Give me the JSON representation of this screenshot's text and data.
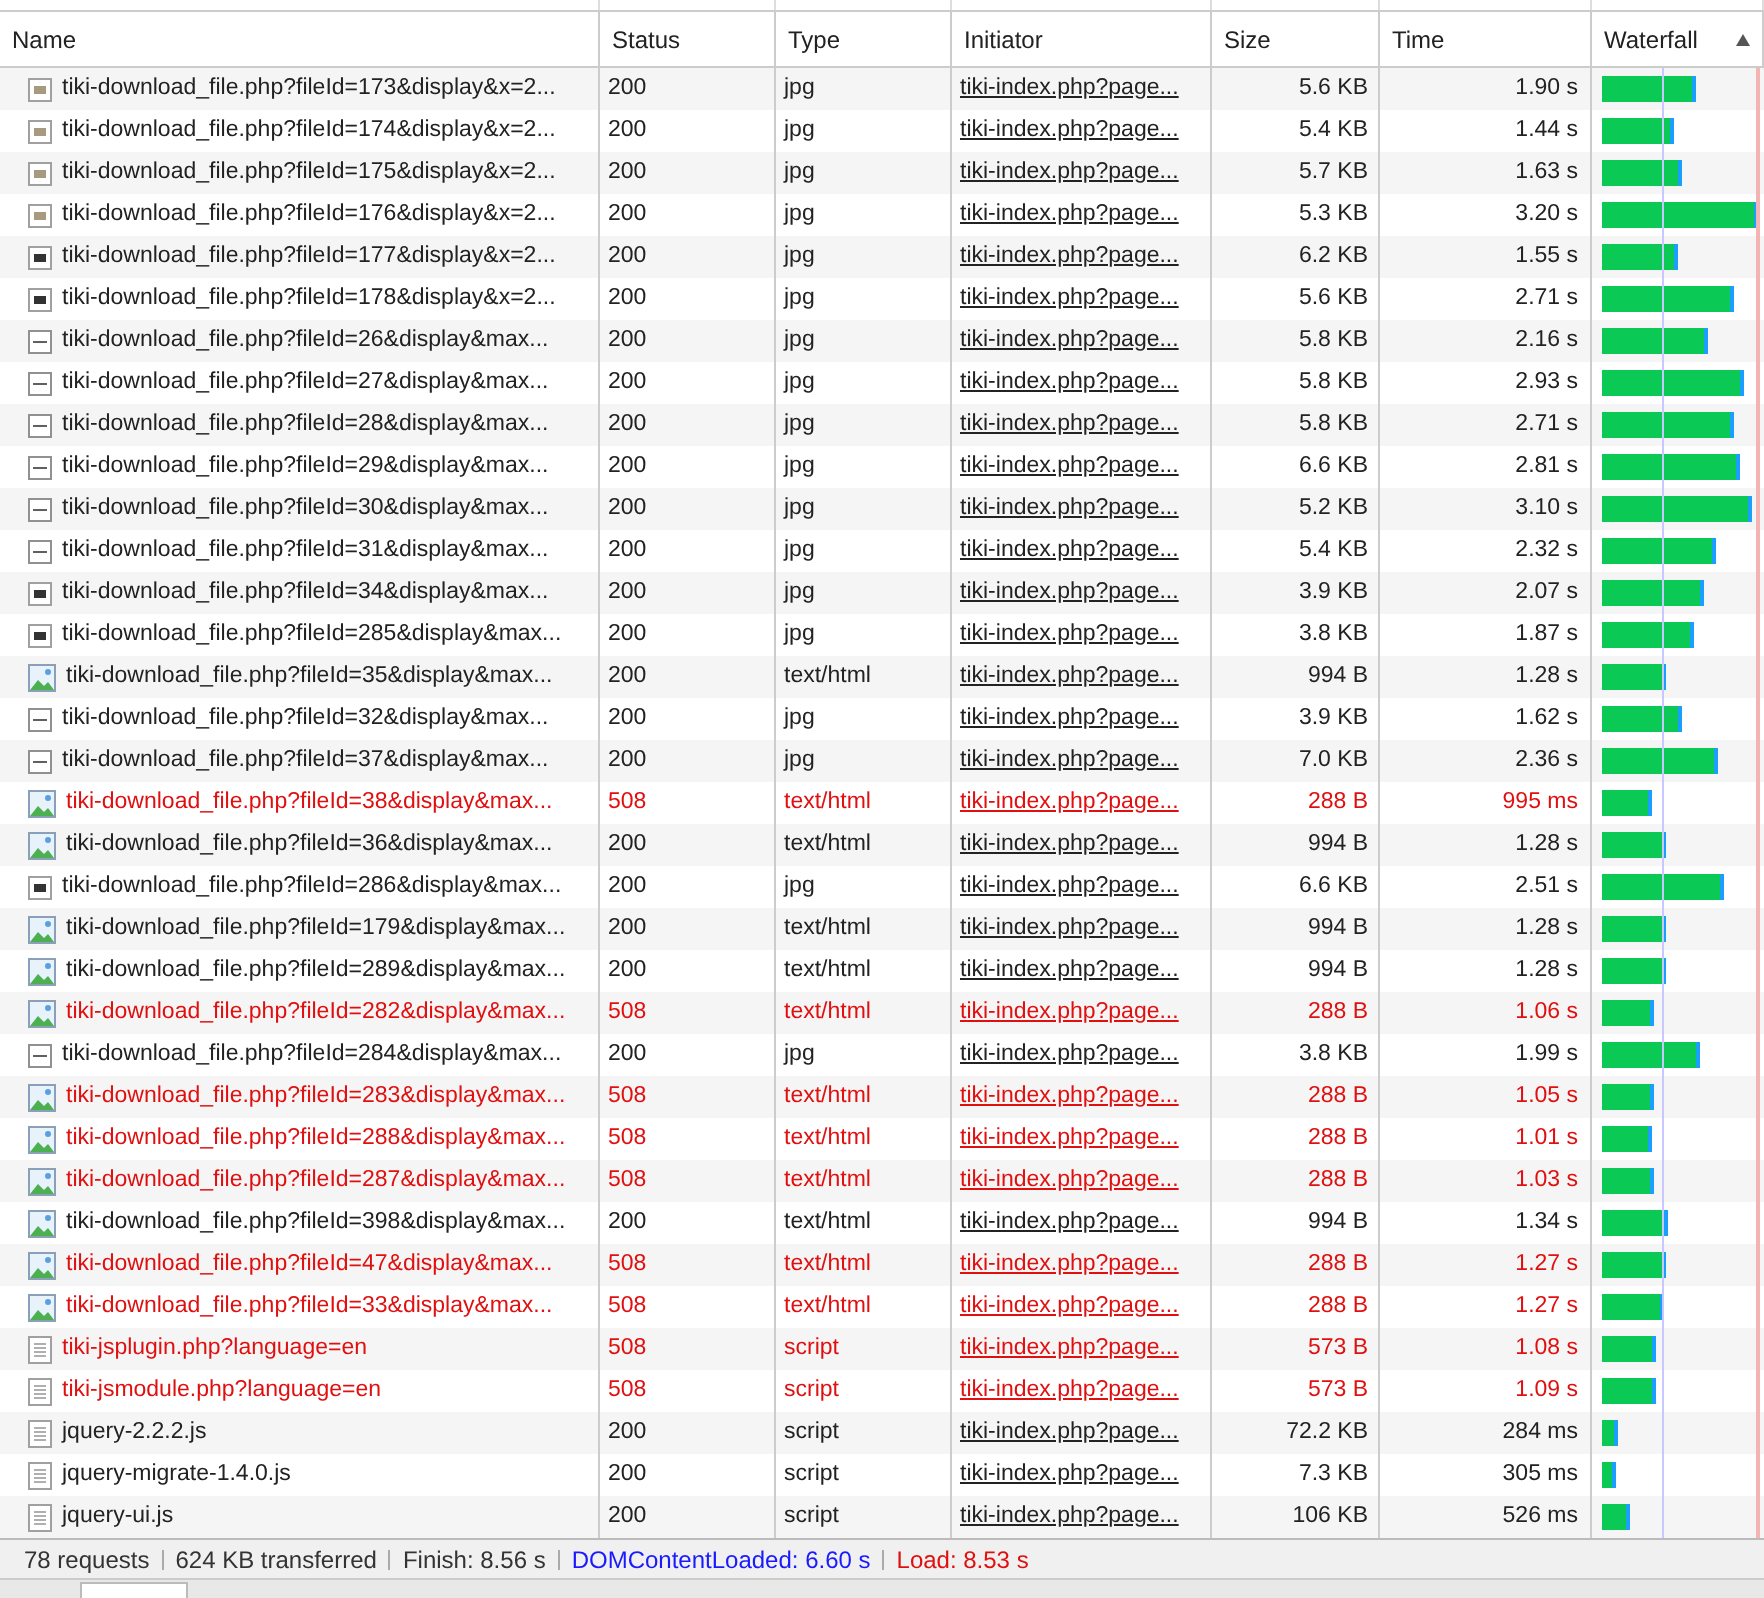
{
  "columns": [
    "Name",
    "Status",
    "Type",
    "Initiator",
    "Size",
    "Time",
    "Waterfall"
  ],
  "rows": [
    {
      "kind": "image",
      "name": "tiki-download_file.php?fileId=173&display&x=2...",
      "status": "200",
      "type": "jpg",
      "initiator": "tiki-index.php?page...",
      "size": "5.6 KB",
      "time": "1.90 s",
      "error": false
    },
    {
      "kind": "image",
      "name": "tiki-download_file.php?fileId=174&display&x=2...",
      "status": "200",
      "type": "jpg",
      "initiator": "tiki-index.php?page...",
      "size": "5.4 KB",
      "time": "1.44 s",
      "error": false
    },
    {
      "kind": "image",
      "name": "tiki-download_file.php?fileId=175&display&x=2...",
      "status": "200",
      "type": "jpg",
      "initiator": "tiki-index.php?page...",
      "size": "5.7 KB",
      "time": "1.63 s",
      "error": false
    },
    {
      "kind": "image",
      "name": "tiki-download_file.php?fileId=176&display&x=2...",
      "status": "200",
      "type": "jpg",
      "initiator": "tiki-index.php?page...",
      "size": "5.3 KB",
      "time": "3.20 s",
      "error": false
    },
    {
      "kind": "photo",
      "name": "tiki-download_file.php?fileId=177&display&x=2...",
      "status": "200",
      "type": "jpg",
      "initiator": "tiki-index.php?page...",
      "size": "6.2 KB",
      "time": "1.55 s",
      "error": false
    },
    {
      "kind": "photo",
      "name": "tiki-download_file.php?fileId=178&display&x=2...",
      "status": "200",
      "type": "jpg",
      "initiator": "tiki-index.php?page...",
      "size": "5.6 KB",
      "time": "2.71 s",
      "error": false
    },
    {
      "kind": "blank",
      "name": "tiki-download_file.php?fileId=26&display&max...",
      "status": "200",
      "type": "jpg",
      "initiator": "tiki-index.php?page...",
      "size": "5.8 KB",
      "time": "2.16 s",
      "error": false
    },
    {
      "kind": "blank",
      "name": "tiki-download_file.php?fileId=27&display&max...",
      "status": "200",
      "type": "jpg",
      "initiator": "tiki-index.php?page...",
      "size": "5.8 KB",
      "time": "2.93 s",
      "error": false
    },
    {
      "kind": "blank",
      "name": "tiki-download_file.php?fileId=28&display&max...",
      "status": "200",
      "type": "jpg",
      "initiator": "tiki-index.php?page...",
      "size": "5.8 KB",
      "time": "2.71 s",
      "error": false
    },
    {
      "kind": "blank",
      "name": "tiki-download_file.php?fileId=29&display&max...",
      "status": "200",
      "type": "jpg",
      "initiator": "tiki-index.php?page...",
      "size": "6.6 KB",
      "time": "2.81 s",
      "error": false
    },
    {
      "kind": "blank",
      "name": "tiki-download_file.php?fileId=30&display&max...",
      "status": "200",
      "type": "jpg",
      "initiator": "tiki-index.php?page...",
      "size": "5.2 KB",
      "time": "3.10 s",
      "error": false
    },
    {
      "kind": "blank",
      "name": "tiki-download_file.php?fileId=31&display&max...",
      "status": "200",
      "type": "jpg",
      "initiator": "tiki-index.php?page...",
      "size": "5.4 KB",
      "time": "2.32 s",
      "error": false
    },
    {
      "kind": "photo",
      "name": "tiki-download_file.php?fileId=34&display&max...",
      "status": "200",
      "type": "jpg",
      "initiator": "tiki-index.php?page...",
      "size": "3.9 KB",
      "time": "2.07 s",
      "error": false
    },
    {
      "kind": "photo",
      "name": "tiki-download_file.php?fileId=285&display&max...",
      "status": "200",
      "type": "jpg",
      "initiator": "tiki-index.php?page...",
      "size": "3.8 KB",
      "time": "1.87 s",
      "error": false
    },
    {
      "kind": "broken",
      "name": "tiki-download_file.php?fileId=35&display&max...",
      "status": "200",
      "type": "text/html",
      "initiator": "tiki-index.php?page...",
      "size": "994 B",
      "time": "1.28 s",
      "error": false
    },
    {
      "kind": "blank",
      "name": "tiki-download_file.php?fileId=32&display&max...",
      "status": "200",
      "type": "jpg",
      "initiator": "tiki-index.php?page...",
      "size": "3.9 KB",
      "time": "1.62 s",
      "error": false
    },
    {
      "kind": "blank",
      "name": "tiki-download_file.php?fileId=37&display&max...",
      "status": "200",
      "type": "jpg",
      "initiator": "tiki-index.php?page...",
      "size": "7.0 KB",
      "time": "2.36 s",
      "error": false
    },
    {
      "kind": "broken",
      "name": "tiki-download_file.php?fileId=38&display&max...",
      "status": "508",
      "type": "text/html",
      "initiator": "tiki-index.php?page...",
      "size": "288 B",
      "time": "995 ms",
      "error": true
    },
    {
      "kind": "broken",
      "name": "tiki-download_file.php?fileId=36&display&max...",
      "status": "200",
      "type": "text/html",
      "initiator": "tiki-index.php?page...",
      "size": "994 B",
      "time": "1.28 s",
      "error": false
    },
    {
      "kind": "photo",
      "name": "tiki-download_file.php?fileId=286&display&max...",
      "status": "200",
      "type": "jpg",
      "initiator": "tiki-index.php?page...",
      "size": "6.6 KB",
      "time": "2.51 s",
      "error": false
    },
    {
      "kind": "broken",
      "name": "tiki-download_file.php?fileId=179&display&max...",
      "status": "200",
      "type": "text/html",
      "initiator": "tiki-index.php?page...",
      "size": "994 B",
      "time": "1.28 s",
      "error": false
    },
    {
      "kind": "broken",
      "name": "tiki-download_file.php?fileId=289&display&max...",
      "status": "200",
      "type": "text/html",
      "initiator": "tiki-index.php?page...",
      "size": "994 B",
      "time": "1.28 s",
      "error": false
    },
    {
      "kind": "broken",
      "name": "tiki-download_file.php?fileId=282&display&max...",
      "status": "508",
      "type": "text/html",
      "initiator": "tiki-index.php?page...",
      "size": "288 B",
      "time": "1.06 s",
      "error": true
    },
    {
      "kind": "blank",
      "name": "tiki-download_file.php?fileId=284&display&max...",
      "status": "200",
      "type": "jpg",
      "initiator": "tiki-index.php?page...",
      "size": "3.8 KB",
      "time": "1.99 s",
      "error": false
    },
    {
      "kind": "broken",
      "name": "tiki-download_file.php?fileId=283&display&max...",
      "status": "508",
      "type": "text/html",
      "initiator": "tiki-index.php?page...",
      "size": "288 B",
      "time": "1.05 s",
      "error": true
    },
    {
      "kind": "broken",
      "name": "tiki-download_file.php?fileId=288&display&max...",
      "status": "508",
      "type": "text/html",
      "initiator": "tiki-index.php?page...",
      "size": "288 B",
      "time": "1.01 s",
      "error": true
    },
    {
      "kind": "broken",
      "name": "tiki-download_file.php?fileId=287&display&max...",
      "status": "508",
      "type": "text/html",
      "initiator": "tiki-index.php?page...",
      "size": "288 B",
      "time": "1.03 s",
      "error": true
    },
    {
      "kind": "broken",
      "name": "tiki-download_file.php?fileId=398&display&max...",
      "status": "200",
      "type": "text/html",
      "initiator": "tiki-index.php?page...",
      "size": "994 B",
      "time": "1.34 s",
      "error": false
    },
    {
      "kind": "broken",
      "name": "tiki-download_file.php?fileId=47&display&max...",
      "status": "508",
      "type": "text/html",
      "initiator": "tiki-index.php?page...",
      "size": "288 B",
      "time": "1.27 s",
      "error": true
    },
    {
      "kind": "broken",
      "name": "tiki-download_file.php?fileId=33&display&max...",
      "status": "508",
      "type": "text/html",
      "initiator": "tiki-index.php?page...",
      "size": "288 B",
      "time": "1.27 s",
      "error": true
    },
    {
      "kind": "document",
      "name": "tiki-jsplugin.php?language=en",
      "status": "508",
      "type": "script",
      "initiator": "tiki-index.php?page...",
      "size": "573 B",
      "time": "1.08 s",
      "error": true
    },
    {
      "kind": "document",
      "name": "tiki-jsmodule.php?language=en",
      "status": "508",
      "type": "script",
      "initiator": "tiki-index.php?page...",
      "size": "573 B",
      "time": "1.09 s",
      "error": true
    },
    {
      "kind": "document",
      "name": "jquery-2.2.2.js",
      "status": "200",
      "type": "script",
      "initiator": "tiki-index.php?page...",
      "size": "72.2 KB",
      "time": "284 ms",
      "error": false
    },
    {
      "kind": "document",
      "name": "jquery-migrate-1.4.0.js",
      "status": "200",
      "type": "script",
      "initiator": "tiki-index.php?page...",
      "size": "7.3 KB",
      "time": "305 ms",
      "error": false
    },
    {
      "kind": "document",
      "name": "jquery-ui.js",
      "status": "200",
      "type": "script",
      "initiator": "tiki-index.php?page...",
      "size": "106 KB",
      "time": "526 ms",
      "error": false
    }
  ],
  "status_bar": [
    {
      "kind": "plain",
      "text": "78 requests"
    },
    {
      "kind": "plain",
      "text": "624 KB transferred"
    },
    {
      "kind": "plain",
      "text": "Finish: 8.56 s"
    },
    {
      "kind": "dom",
      "text": "DOMContentLoaded: 6.60 s"
    },
    {
      "kind": "load",
      "text": "Load: 8.53 s"
    }
  ]
}
